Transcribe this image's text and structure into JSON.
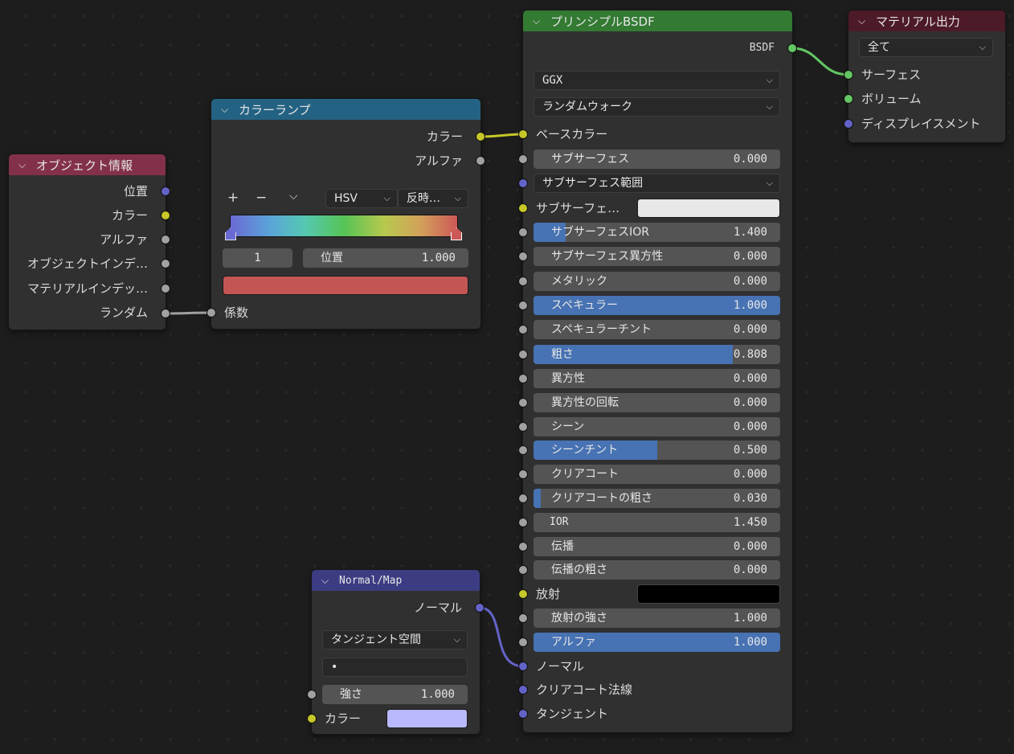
{
  "object_info": {
    "title": "オブジェクト情報",
    "outputs": [
      "位置",
      "カラー",
      "アルファ",
      "オブジェクトインデ…",
      "マテリアルインデッ…",
      "ランダム"
    ]
  },
  "color_ramp": {
    "title": "カラーランプ",
    "outputs": [
      "カラー",
      "アルファ"
    ],
    "add_icon": "plus-icon",
    "remove_icon": "minus-icon",
    "menu_icon": "chevron-down-icon",
    "color_mode": "HSV",
    "interpolation": "反時…",
    "stop_index": "1",
    "position_label": "位置",
    "position_value": "1.000",
    "stop_color": "#c45555",
    "input_label": "係数"
  },
  "normal_map": {
    "title": "Normal/Map",
    "output": "ノーマル",
    "space": "タンジェント空間",
    "uv_map": "•",
    "strength_label": "強さ",
    "strength_value": "1.000",
    "color_label": "カラー",
    "color_swatch": "#b9b9ff"
  },
  "bsdf": {
    "title": "プリンシプルBSDF",
    "output": "BSDF",
    "distribution": "GGX",
    "subsurface_method": "ランダムウォーク",
    "base_color_label": "ベースカラー",
    "subsurface_label": "サブサーフェス",
    "subsurface_value": "0.000",
    "subsurface_radius": "サブサーフェス範囲",
    "subsurface_color_label": "サブサーフェ…",
    "subsurface_color": "#e8e8e8",
    "params": [
      {
        "label": "サブサーフェスIOR",
        "value": "1.400",
        "fill": 0.13
      },
      {
        "label": "サブサーフェス異方性",
        "value": "0.000",
        "fill": 0
      },
      {
        "label": "メタリック",
        "value": "0.000",
        "fill": 0
      },
      {
        "label": "スペキュラー",
        "value": "1.000",
        "fill": 1
      },
      {
        "label": "スペキュラーチント",
        "value": "0.000",
        "fill": 0
      },
      {
        "label": "粗さ",
        "value": "0.808",
        "fill": 0.808
      },
      {
        "label": "異方性",
        "value": "0.000",
        "fill": 0
      },
      {
        "label": "異方性の回転",
        "value": "0.000",
        "fill": 0
      },
      {
        "label": "シーン",
        "value": "0.000",
        "fill": 0
      },
      {
        "label": "シーンチント",
        "value": "0.500",
        "fill": 0.5
      },
      {
        "label": "クリアコート",
        "value": "0.000",
        "fill": 0
      },
      {
        "label": "クリアコートの粗さ",
        "value": "0.030",
        "fill": 0.03
      },
      {
        "label": "IOR",
        "value": "1.450",
        "fill": 0
      },
      {
        "label": "伝播",
        "value": "0.000",
        "fill": 0
      },
      {
        "label": "伝播の粗さ",
        "value": "0.000",
        "fill": 0
      }
    ],
    "emission_label": "放射",
    "emission_color": "#000000",
    "emission_strength_label": "放射の強さ",
    "emission_strength_value": "1.000",
    "alpha_label": "アルファ",
    "alpha_value": "1.000",
    "inputs_tail": [
      "ノーマル",
      "クリアコート法線",
      "タンジェント"
    ]
  },
  "material_output": {
    "title": "マテリアル出力",
    "target": "全て",
    "inputs": [
      "サーフェス",
      "ボリューム",
      "ディスプレイスメント"
    ]
  },
  "colors": {
    "header_input": "#83314a",
    "header_converter": "#246283",
    "header_vector": "#3c3c83",
    "header_shader": "#337a33",
    "header_output": "#4d1a27",
    "slider_fill": "#4772b3",
    "link_yellow": "#c7c729",
    "link_green": "#63c763",
    "link_blue": "#6363c7",
    "link_grey": "#a1a1a1"
  }
}
